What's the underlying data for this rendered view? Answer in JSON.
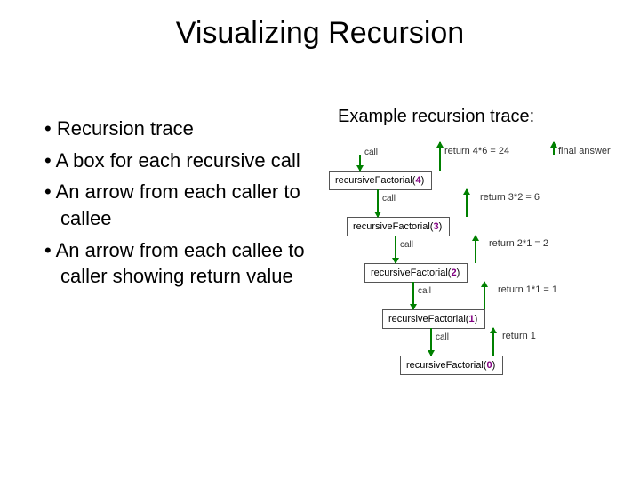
{
  "title": "Visualizing Recursion",
  "bullets": [
    "Recursion trace",
    "A box for each recursive call",
    "An arrow from each caller to callee",
    "An arrow from each callee to caller showing return value"
  ],
  "subtitle": "Example recursion trace:",
  "diagram": {
    "call_label": "call",
    "final_label": "final answer",
    "boxes": [
      {
        "fn": "recursiveFactorial(",
        "arg": "4",
        "close": ")"
      },
      {
        "fn": "recursiveFactorial(",
        "arg": "3",
        "close": ")"
      },
      {
        "fn": "recursiveFactorial(",
        "arg": "2",
        "close": ")"
      },
      {
        "fn": "recursiveFactorial(",
        "arg": "1",
        "close": ")"
      },
      {
        "fn": "recursiveFactorial(",
        "arg": "0",
        "close": ")"
      }
    ],
    "returns": [
      {
        "text_a": "return ",
        "expr": "4*6 = 24"
      },
      {
        "text_a": "return ",
        "expr": "3*2 = 6"
      },
      {
        "text_a": "return ",
        "expr": "2*1 = 2"
      },
      {
        "text_a": "return ",
        "expr": "1*1 = 1"
      },
      {
        "text_a": "return ",
        "expr": "1"
      }
    ]
  }
}
